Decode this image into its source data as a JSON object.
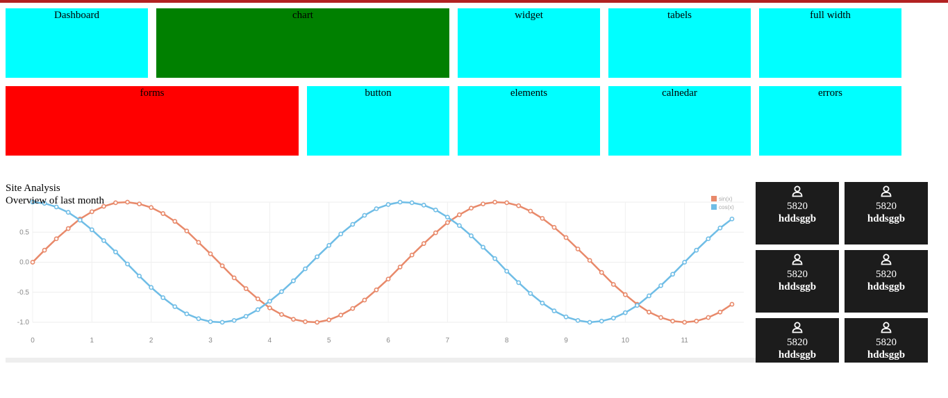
{
  "nav": {
    "row1": [
      {
        "label": "Dashboard",
        "color": "#00ffff"
      },
      {
        "label": "chart",
        "color": "#008000"
      },
      {
        "label": "widget",
        "color": "#00ffff"
      },
      {
        "label": "tabels",
        "color": "#00ffff"
      },
      {
        "label": "full width",
        "color": "#00ffff"
      }
    ],
    "row2": [
      {
        "label": "forms",
        "color": "#ff0000"
      },
      {
        "label": "button",
        "color": "#00ffff"
      },
      {
        "label": "elements",
        "color": "#00ffff"
      },
      {
        "label": "calnedar",
        "color": "#00ffff"
      },
      {
        "label": "errors",
        "color": "#00ffff"
      }
    ]
  },
  "analysis": {
    "title": "Site Analysis",
    "subtitle": "Overview of last month"
  },
  "stats": [
    {
      "value": "5820",
      "label": "hddsggb",
      "icon": "user-icon"
    },
    {
      "value": "5820",
      "label": "hddsggb",
      "icon": "user-icon"
    },
    {
      "value": "5820",
      "label": "hddsggb",
      "icon": "user-icon"
    },
    {
      "value": "5820",
      "label": "hddsggb",
      "icon": "user-icon"
    },
    {
      "value": "5820",
      "label": "hddsggb",
      "icon": "user-icon"
    },
    {
      "value": "5820",
      "label": "hddsggb",
      "icon": "user-icon"
    }
  ],
  "chart_data": {
    "type": "line",
    "title": "",
    "xlabel": "",
    "ylabel": "",
    "xlim": [
      0,
      12
    ],
    "ylim": [
      -1.0,
      1.0
    ],
    "x_ticks": [
      0,
      1,
      2,
      3,
      4,
      5,
      6,
      7,
      8,
      9,
      10,
      11
    ],
    "y_ticks": [
      -1.0,
      -0.5,
      0.0,
      0.5
    ],
    "y_tick_labels": [
      "-1.0",
      "-0.5",
      "0.0",
      "0.5"
    ],
    "grid": true,
    "legend": "top-right",
    "x": [
      0,
      0.2,
      0.4,
      0.6,
      0.8,
      1.0,
      1.2,
      1.4,
      1.6,
      1.8,
      2.0,
      2.2,
      2.4,
      2.6,
      2.8,
      3.0,
      3.2,
      3.4,
      3.6,
      3.8,
      4.0,
      4.2,
      4.4,
      4.6,
      4.8,
      5.0,
      5.2,
      5.4,
      5.6,
      5.8,
      6.0,
      6.2,
      6.4,
      6.6,
      6.8,
      7.0,
      7.2,
      7.4,
      7.6,
      7.8,
      8.0,
      8.2,
      8.4,
      8.6,
      8.8,
      9.0,
      9.2,
      9.4,
      9.6,
      9.8,
      10.0,
      10.2,
      10.4,
      10.6,
      10.8,
      11.0,
      11.2,
      11.4,
      11.6,
      11.8
    ],
    "series": [
      {
        "name": "sin(x)",
        "color": "#e8896a",
        "values": [
          0.0,
          0.2,
          0.39,
          0.56,
          0.72,
          0.84,
          0.93,
          0.99,
          1.0,
          0.97,
          0.91,
          0.81,
          0.68,
          0.52,
          0.33,
          0.14,
          -0.06,
          -0.26,
          -0.44,
          -0.61,
          -0.76,
          -0.87,
          -0.95,
          -0.99,
          -1.0,
          -0.96,
          -0.88,
          -0.77,
          -0.63,
          -0.46,
          -0.28,
          -0.08,
          0.12,
          0.31,
          0.49,
          0.66,
          0.79,
          0.9,
          0.97,
          1.0,
          0.99,
          0.94,
          0.85,
          0.73,
          0.58,
          0.41,
          0.22,
          0.03,
          -0.17,
          -0.37,
          -0.54,
          -0.7,
          -0.83,
          -0.92,
          -0.98,
          -1.0,
          -0.98,
          -0.92,
          -0.83,
          -0.7
        ]
      },
      {
        "name": "cos(x)",
        "color": "#6fbde6",
        "values": [
          1.0,
          0.98,
          0.92,
          0.83,
          0.7,
          0.54,
          0.36,
          0.17,
          -0.03,
          -0.23,
          -0.42,
          -0.59,
          -0.74,
          -0.86,
          -0.94,
          -0.99,
          -1.0,
          -0.97,
          -0.9,
          -0.79,
          -0.65,
          -0.49,
          -0.31,
          -0.11,
          0.09,
          0.28,
          0.47,
          0.63,
          0.78,
          0.89,
          0.96,
          1.0,
          0.99,
          0.95,
          0.87,
          0.75,
          0.61,
          0.44,
          0.25,
          0.06,
          -0.15,
          -0.34,
          -0.52,
          -0.68,
          -0.81,
          -0.91,
          -0.97,
          -1.0,
          -0.98,
          -0.93,
          -0.84,
          -0.72,
          -0.56,
          -0.39,
          -0.2,
          0.0,
          0.2,
          0.39,
          0.57,
          0.72
        ]
      }
    ]
  }
}
